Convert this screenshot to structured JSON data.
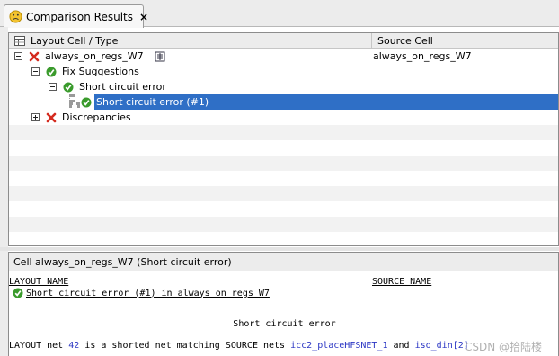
{
  "tab": {
    "label": "Comparison Results",
    "close_label": "×",
    "icon": "sad-face-icon"
  },
  "tree": {
    "columns": [
      "Layout Cell / Type",
      "Source Cell"
    ],
    "rows": [
      {
        "label": "always_on_regs_W7",
        "source": "always_on_regs_W7",
        "icon": "red-x-icon",
        "expander": "minus",
        "extra_icon": "hierarchy-icon"
      },
      {
        "label": "Fix Suggestions",
        "icon": "green-check-icon",
        "expander": "minus"
      },
      {
        "label": "Short circuit error",
        "icon": "green-check-icon",
        "expander": "minus"
      },
      {
        "label": "Short circuit error (#1)",
        "icon": "green-check-icon",
        "selected": true
      },
      {
        "label": "Discrepancies",
        "icon": "red-x-icon",
        "expander": "plus"
      }
    ]
  },
  "detail": {
    "title": "Cell always_on_regs_W7 (Short circuit error)",
    "layout_header": "LAYOUT NAME",
    "source_header": "SOURCE NAME",
    "item": "Short circuit error (#1) in always_on_regs_W7",
    "center_heading": "Short circuit error",
    "net_line": {
      "prefix": "LAYOUT net ",
      "net_id": "42",
      "middle": " is a shorted net matching SOURCE nets ",
      "net_a": "icc2_placeHFSNET_1",
      "and_word": " and ",
      "net_b": "iso_din[2]"
    },
    "watermark": "CSDN @拾陆楼"
  },
  "colors": {
    "selection": "#2f6fc6",
    "error_red": "#d42a1e",
    "ok_green": "#3a9b2c",
    "link_blue": "#2b36c4"
  }
}
